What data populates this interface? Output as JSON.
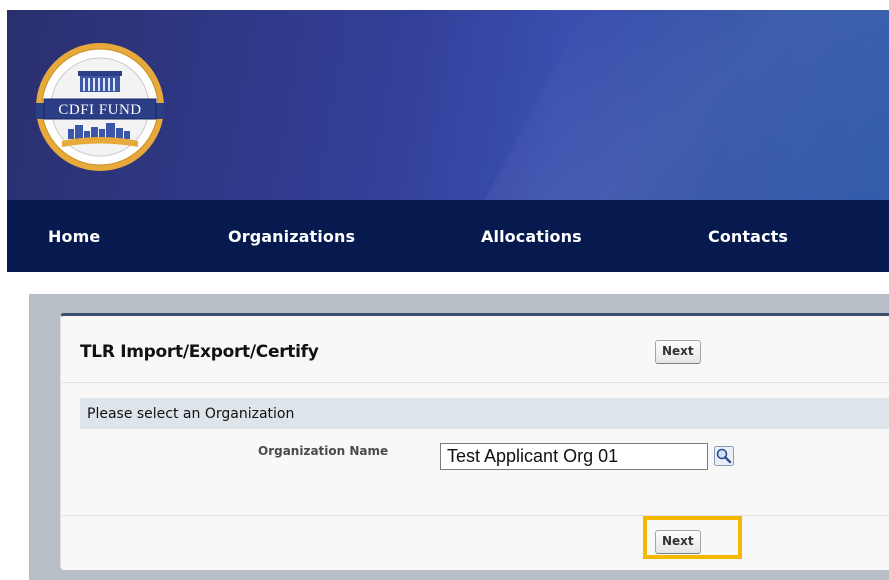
{
  "header": {
    "logo_text": "CDFI FUND",
    "brand_colors": {
      "banner": "#33409a",
      "nav": "#061a4f",
      "accent": "#f5b800"
    }
  },
  "nav": {
    "items": [
      {
        "label": "Home"
      },
      {
        "label": "Organizations"
      },
      {
        "label": "Allocations"
      },
      {
        "label": "Contacts"
      }
    ]
  },
  "panel": {
    "title": "TLR Import/Export/Certify",
    "top_button": "Next",
    "section_title": "Please select an Organization",
    "field": {
      "label": "Organization Name",
      "value": "Test Applicant Org 01",
      "lookup_icon": "magnifier-icon"
    },
    "bottom_button": "Next"
  }
}
